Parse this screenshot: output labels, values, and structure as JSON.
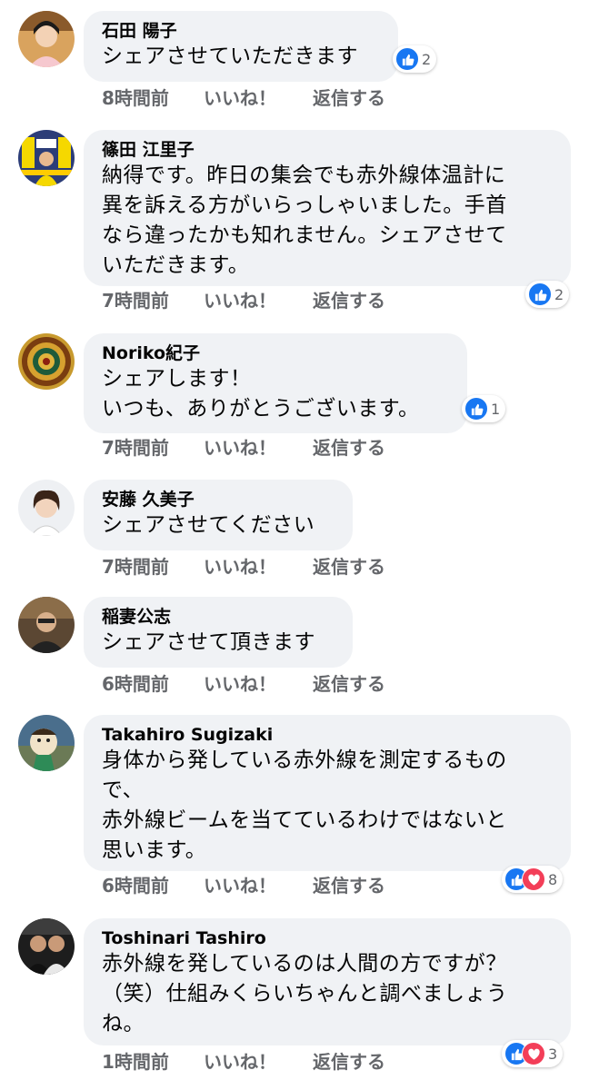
{
  "comments": [
    {
      "author": "石田 陽子",
      "text": "シェアさせていただきます",
      "time": "8時間前",
      "like_label": "いいね！",
      "reply_label": "返信する",
      "reactions": {
        "types": [
          "like"
        ],
        "count": "2"
      }
    },
    {
      "author": "篠田 江里子",
      "text": "納得です。昨日の集会でも赤外線体温計に\n異を訴える方がいらっしゃいました。手首\nなら違ったかも知れません。シェアさせて\nいただきます。",
      "time": "7時間前",
      "like_label": "いいね！",
      "reply_label": "返信する",
      "reactions": {
        "types": [
          "like"
        ],
        "count": "2"
      }
    },
    {
      "author": "Noriko紀子",
      "text": "シェアします！\nいつも、ありがとうございます。",
      "time": "7時間前",
      "like_label": "いいね！",
      "reply_label": "返信する",
      "reactions": {
        "types": [
          "like"
        ],
        "count": "1"
      }
    },
    {
      "author": "安藤 久美子",
      "text": "シェアさせてください",
      "time": "7時間前",
      "like_label": "いいね！",
      "reply_label": "返信する",
      "reactions": null
    },
    {
      "author": "稲妻公志",
      "text": "シェアさせて頂きます",
      "time": "6時間前",
      "like_label": "いいね！",
      "reply_label": "返信する",
      "reactions": null
    },
    {
      "author": "Takahiro Sugizaki",
      "text": "身体から発している赤外線を測定するもの\nで、\n赤外線ビームを当てているわけではないと\n思います。",
      "time": "6時間前",
      "like_label": "いいね！",
      "reply_label": "返信する",
      "reactions": {
        "types": [
          "like",
          "love"
        ],
        "count": "8"
      }
    },
    {
      "author": "Toshinari Tashiro",
      "text": "赤外線を発しているのは人間の方ですが？\n（笑）仕組みくらいちゃんと調べましょう\nね。",
      "time": "1時間前",
      "like_label": "いいね！",
      "reply_label": "返信する",
      "reactions": {
        "types": [
          "like",
          "love"
        ],
        "count": "3"
      }
    }
  ],
  "colors": {
    "bubble": "#f0f2f5",
    "meta_text": "#65676b",
    "like_blue": "#1877f2",
    "love_red": "#f33e58"
  }
}
